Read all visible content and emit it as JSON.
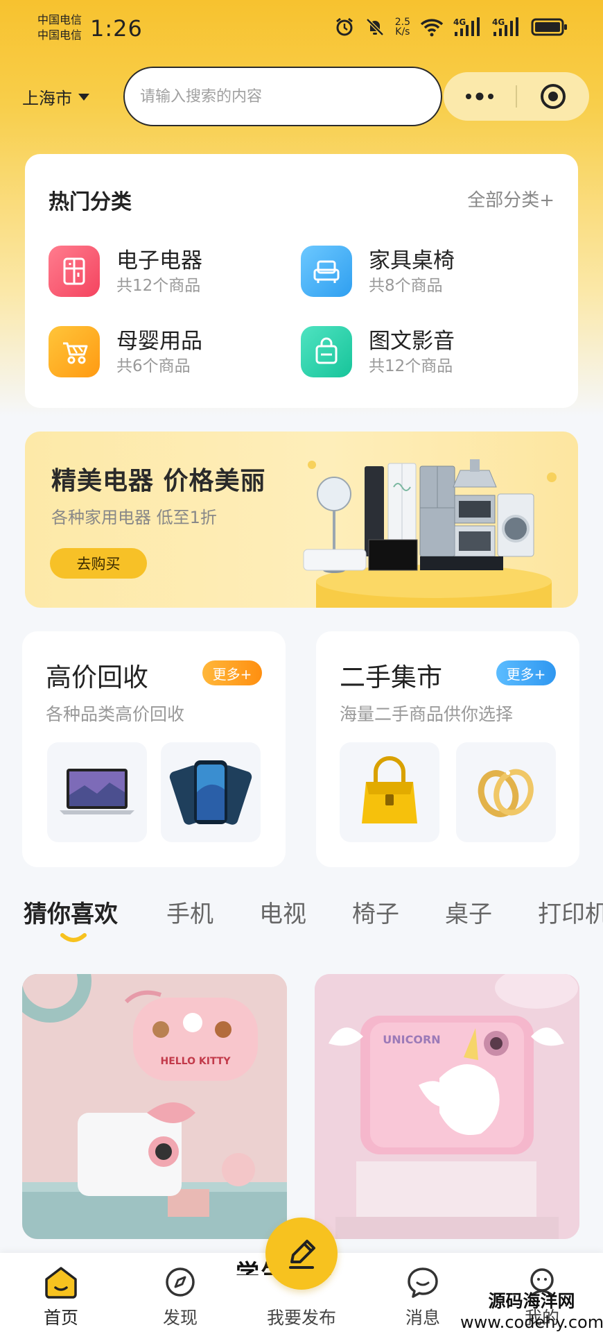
{
  "status_bar": {
    "carrier_1": "中国电信",
    "carrier_2": "中国电信",
    "time": "1:26",
    "net_speed_value": "2.5",
    "net_speed_unit": "K/s",
    "signal_1": "4G",
    "signal_2": "4G"
  },
  "header": {
    "city": "上海市",
    "search_placeholder": "请输入搜索的内容"
  },
  "categories": {
    "title": "热门分类",
    "all_link": "全部分类+",
    "items": [
      {
        "name": "电子电器",
        "count": "共12个商品",
        "icon": "fridge-icon",
        "color_from": "#ff7c8e",
        "color_to": "#f4445f"
      },
      {
        "name": "家具桌椅",
        "count": "共8个商品",
        "icon": "sofa-icon",
        "color_from": "#6cc8ff",
        "color_to": "#2f9ff0"
      },
      {
        "name": "母婴用品",
        "count": "共6个商品",
        "icon": "stroller-icon",
        "color_from": "#ffc53a",
        "color_to": "#ff9a12"
      },
      {
        "name": "图文影音",
        "count": "共12个商品",
        "icon": "bag-icon",
        "color_from": "#4fe3c1",
        "color_to": "#17c49a"
      }
    ]
  },
  "banner": {
    "title": "精美电器 价格美丽",
    "subtitle": "各种家用电器 低至1折",
    "button": "去购买"
  },
  "recycle": {
    "title": "高价回收",
    "more": "更多+",
    "subtitle": "各种品类高价回收",
    "accent": "#ffa11c"
  },
  "market": {
    "title": "二手集市",
    "more": "更多+",
    "subtitle": "海量二手商品供你选择",
    "accent": "#36a8f5"
  },
  "tabs": [
    "猜你喜欢",
    "手机",
    "电视",
    "椅子",
    "桌子",
    "打印机"
  ],
  "products": [
    {
      "sticker_text": "HELLO KITTY"
    },
    {
      "sticker_text": "UNICORN"
    }
  ],
  "peek_text": "学生儿童",
  "bottom_nav": [
    {
      "label": "首页",
      "icon": "home-icon"
    },
    {
      "label": "发现",
      "icon": "compass-icon"
    },
    {
      "label": "我要发布",
      "icon": "pencil-icon"
    },
    {
      "label": "消息",
      "icon": "message-icon"
    },
    {
      "label": "我的",
      "icon": "user-icon"
    }
  ],
  "watermark": {
    "line1": "源码海洋网",
    "line2": "www.codehy.com"
  },
  "colors": {
    "brand_yellow": "#f7c21f",
    "background": "#f5f7fa"
  }
}
